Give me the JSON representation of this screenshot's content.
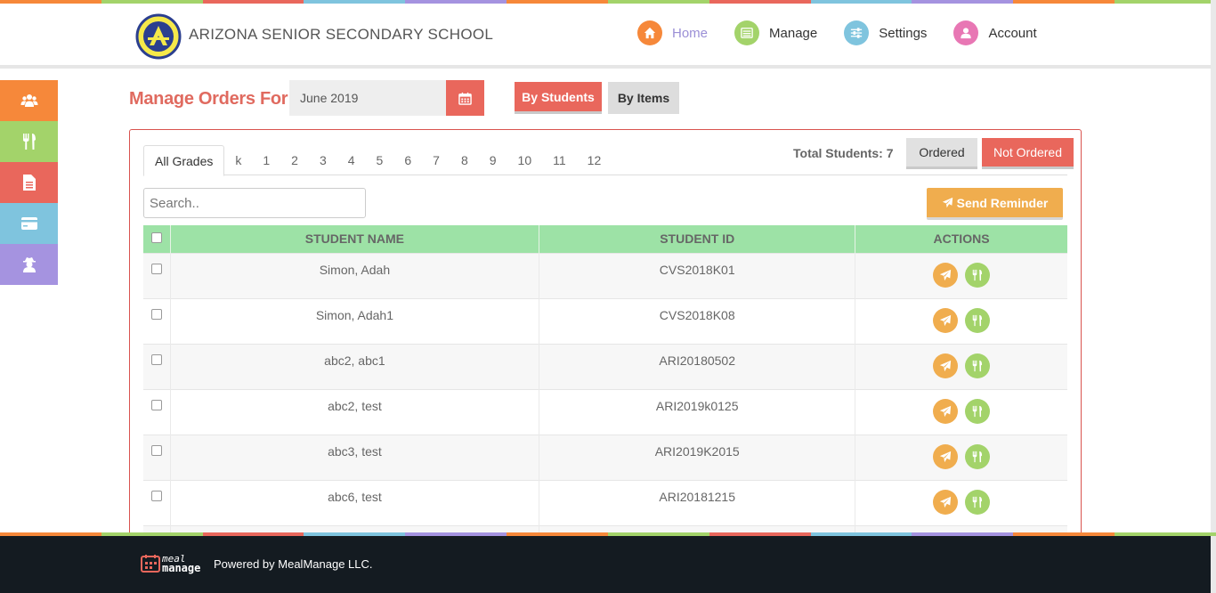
{
  "colors": {
    "rainbow": [
      "#f6883a",
      "#a3d36a",
      "#e9675c",
      "#7fc4de",
      "#a593e0",
      "#f6883a",
      "#a3d36a",
      "#e9675c",
      "#7fc4de",
      "#a593e0",
      "#f6883a",
      "#a3d36a"
    ],
    "accent": "#e9675c",
    "sidebar": [
      "#f6883a",
      "#a3d36a",
      "#e9675c",
      "#7fc4de",
      "#a593e0"
    ],
    "nav": [
      "#f6883a",
      "#a3d36a",
      "#7fc4de",
      "#e877b4"
    ]
  },
  "header": {
    "school_name": "ARIZONA SENIOR SECONDARY SCHOOL",
    "nav": [
      {
        "label": "Home",
        "icon": "home-icon",
        "active": true
      },
      {
        "label": "Manage",
        "icon": "list-icon",
        "active": false
      },
      {
        "label": "Settings",
        "icon": "sliders-icon",
        "active": false
      },
      {
        "label": "Account",
        "icon": "user-icon",
        "active": false
      }
    ]
  },
  "sidebar": {
    "items": [
      {
        "icon": "users-icon"
      },
      {
        "icon": "utensils-icon"
      },
      {
        "icon": "document-icon"
      },
      {
        "icon": "credit-card-icon"
      },
      {
        "icon": "user-secret-icon"
      }
    ]
  },
  "toolbar": {
    "title": "Manage Orders For:",
    "month_value": "June 2019",
    "by_students_label": "By Students",
    "by_items_label": "By Items"
  },
  "panel": {
    "tabs": [
      "All Grades",
      "k",
      "1",
      "2",
      "3",
      "4",
      "5",
      "6",
      "7",
      "8",
      "9",
      "10",
      "11",
      "12"
    ],
    "active_tab": "All Grades",
    "total_students": "Total Students: 7",
    "ordered_label": "Ordered",
    "not_ordered_label": "Not Ordered",
    "search_placeholder": "Search..",
    "send_reminder_label": "Send Reminder",
    "table": {
      "headers": [
        "STUDENT NAME",
        "STUDENT ID",
        "ACTIONS"
      ],
      "rows": [
        {
          "name": "Simon, Adah",
          "id": "CVS2018K01"
        },
        {
          "name": "Simon, Adah1",
          "id": "CVS2018K08"
        },
        {
          "name": "abc2, abc1",
          "id": "ARI20180502"
        },
        {
          "name": "abc2, test",
          "id": "ARI2019k0125"
        },
        {
          "name": "abc3, test",
          "id": "ARI2019K2015"
        },
        {
          "name": "abc6, test",
          "id": "ARI20181215"
        },
        {
          "name": "",
          "id": ""
        }
      ]
    }
  },
  "footer": {
    "brand_line1": "meal",
    "brand_line2": "manage",
    "text": "Powered by MealManage LLC."
  }
}
